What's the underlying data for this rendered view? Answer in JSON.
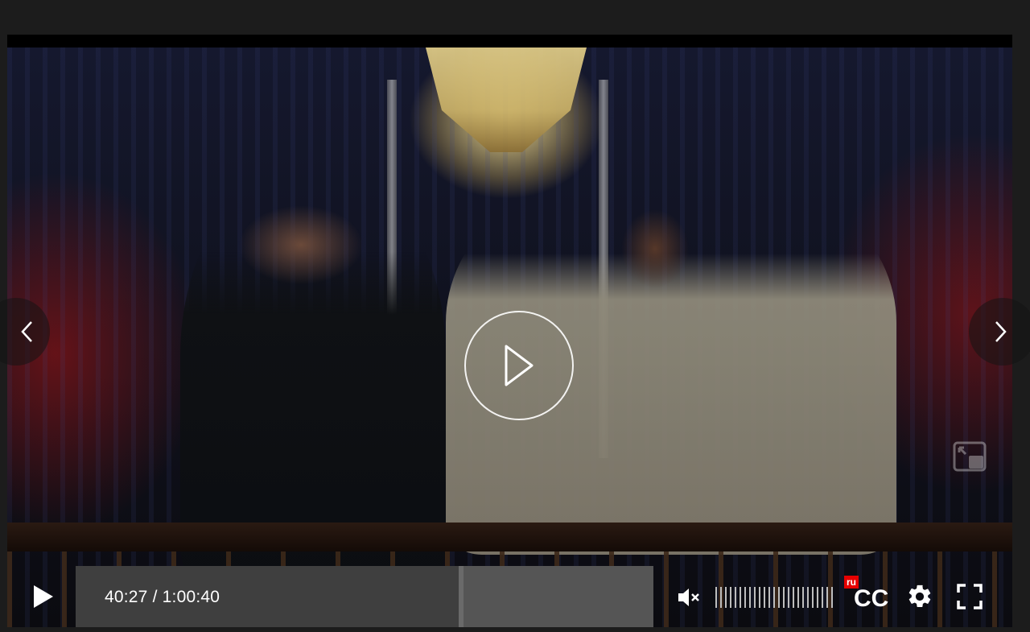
{
  "player": {
    "time_current": "40:27",
    "time_separator": " / ",
    "time_total": "1:00:40",
    "progress_fraction": 0.667,
    "volume_muted": true,
    "subtitle_language": "ru",
    "cc_label": "CC"
  },
  "icons": {
    "prev": "chevron-left-icon",
    "next": "chevron-right-icon",
    "big_play": "play-circle-icon",
    "play": "play-icon",
    "mute": "volume-mute-icon",
    "settings": "gear-icon",
    "fullscreen": "fullscreen-icon",
    "pip": "picture-in-picture-icon"
  },
  "colors": {
    "page_background": "#1c1c1c",
    "cc_badge": "#e60000",
    "icon": "#ffffff"
  }
}
